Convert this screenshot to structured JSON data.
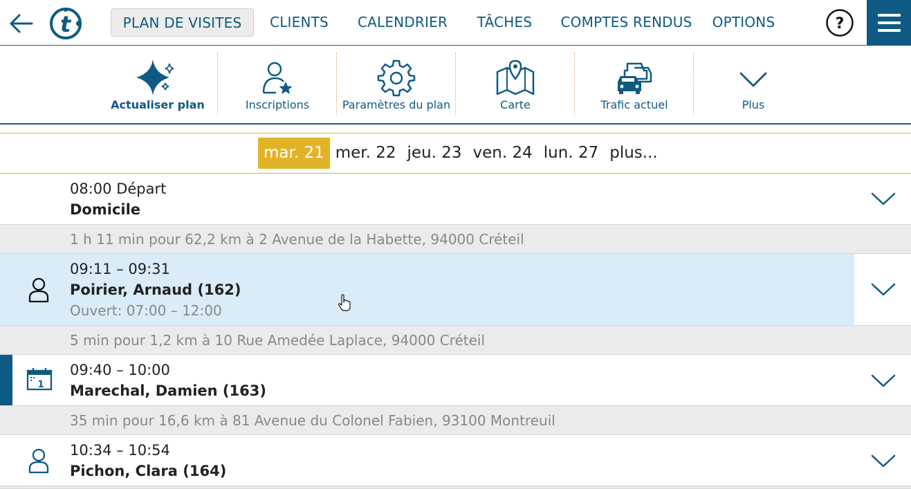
{
  "nav": {
    "back_icon": "arrow-left-icon",
    "logo_letter": "t",
    "tabs": [
      {
        "label": "PLAN DE VISITES",
        "active": true
      },
      {
        "label": "CLIENTS",
        "active": false
      },
      {
        "label": "CALENDRIER",
        "active": false
      },
      {
        "label": "TÂCHES",
        "active": false
      },
      {
        "label": "COMPTES RENDUS",
        "active": false
      },
      {
        "label": "OPTIONS",
        "active": false
      }
    ],
    "help_label": "?",
    "menu_icon": "hamburger-menu-icon"
  },
  "toolbar": {
    "items": [
      {
        "label": "Actualiser plan",
        "icon": "sparkle-icon"
      },
      {
        "label": "Inscriptions",
        "icon": "user-star-icon"
      },
      {
        "label": "Paramètres du plan",
        "icon": "gear-icon"
      },
      {
        "label": "Carte",
        "icon": "map-icon"
      },
      {
        "label": "Trafic actuel",
        "icon": "traffic-cars-icon"
      },
      {
        "label": "Plus",
        "icon": "chevron-down-icon"
      }
    ]
  },
  "dates": [
    {
      "label": "mar. 21",
      "active": true
    },
    {
      "label": "mer. 22",
      "active": false
    },
    {
      "label": "jeu. 23",
      "active": false
    },
    {
      "label": "ven. 24",
      "active": false
    },
    {
      "label": "lun. 27",
      "active": false
    },
    {
      "label": "plus...",
      "active": false
    }
  ],
  "schedule": {
    "start": {
      "time": "08:00 Départ",
      "place": "Domicile"
    },
    "travel1": "1 h 11 min pour 62,2 km à 2 Avenue de la Habette, 94000 Créteil",
    "visit1": {
      "time": "09:11 – 09:31",
      "name": "Poirier, Arnaud (162)",
      "hours": "Ouvert: 07:00 – 12:00",
      "icon": "person-icon"
    },
    "travel2": "5 min pour 1,2 km à 10 Rue Amedée Laplace, 94000 Créteil",
    "visit2": {
      "time": "09:40 – 10:00",
      "name": "Marechal, Damien (163)",
      "icon": "calendar-icon",
      "calendar_day": "1"
    },
    "travel3": "35 min pour 16,6 km à 81 Avenue du Colonel Fabien, 93100 Montreuil",
    "visit3": {
      "time": "10:34 – 10:54",
      "name": "Pichon, Clara (164)",
      "icon": "person-icon"
    }
  },
  "colors": {
    "brand": "#0f5a82",
    "accent_gold": "#e1b327",
    "selected_row": "#d9ecf8",
    "travel_bg": "#ebebeb"
  }
}
